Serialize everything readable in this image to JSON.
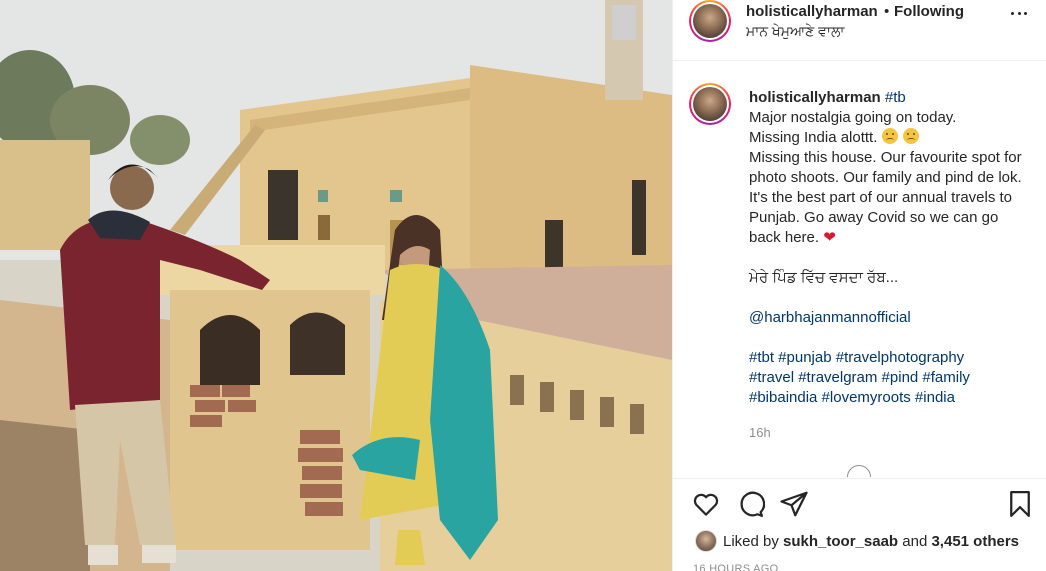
{
  "post": {
    "username": "holisticallyharman",
    "dot": "•",
    "follow_status": "Following",
    "location": "ਮਾਨ ਖੇਮੁਆਣੇ ਵਾਲਾ"
  },
  "caption": {
    "username": "holisticallyharman",
    "hashtag_tb": "#tb",
    "line1": "Major nostalgia going on today.",
    "line2": "Missing India alottt.",
    "line3": "Missing this house. Our favourite spot for photo shoots. Our family and pind de lok. It's the best part of our annual travels to Punjab. Go away Covid so we can go back here.",
    "punjabi_line": "ਮੇਰੇ ਪਿੰਡ ਵਿੱਚ ਵਸਦਾ ਰੱਬ...",
    "mention": "@harbhajanmannofficial",
    "hashtags_line1": "#tbt #punjab #travelphotography",
    "hashtags_line2": "#travel #travelgram #pind #family",
    "hashtags_line3": "#bibaindia #lovemyroots #india",
    "time": "16h"
  },
  "likes": {
    "prefix": "Liked by",
    "user": "sukh_toor_saab",
    "and": "and",
    "others": "3,451 others"
  },
  "timestamp": "16 HOURS AGO",
  "icons": [
    "more-options-icon",
    "heart-icon",
    "comment-icon",
    "share-icon",
    "bookmark-icon"
  ],
  "colors": {
    "link": "#00376b",
    "muted": "#8e8e8e",
    "heart": "#d7192e",
    "text": "#262626"
  }
}
